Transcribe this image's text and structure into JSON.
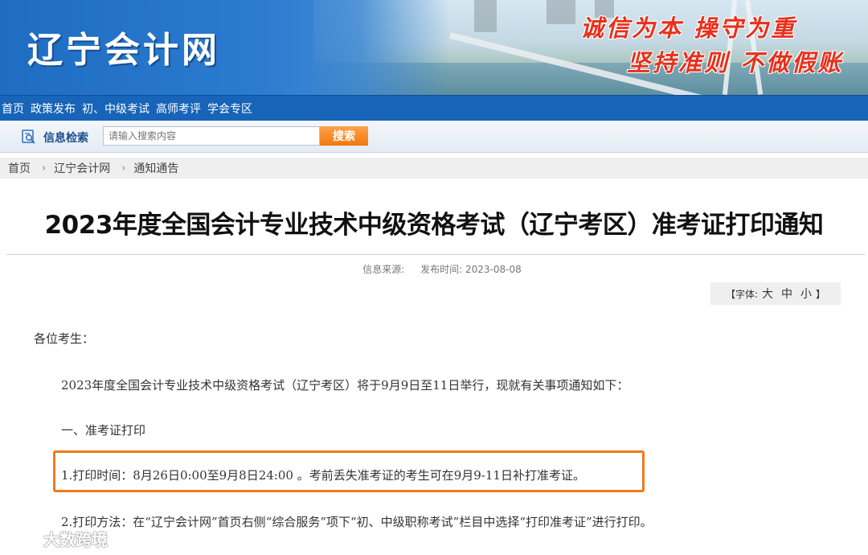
{
  "banner": {
    "logo": "辽宁会计网",
    "slogan_line1": "诚信为本 操守为重",
    "slogan_line2": "坚持准则 不做假账"
  },
  "nav": {
    "items": [
      "首页",
      "政策发布",
      "初、中级考试",
      "高师考评",
      "学会专区"
    ]
  },
  "search": {
    "title": "信息检索",
    "placeholder": "请输入搜索内容",
    "button": "搜索"
  },
  "breadcrumb": [
    "首页",
    "辽宁会计网",
    "通知通告"
  ],
  "article": {
    "title": "2023年度全国会计专业技术中级资格考试（辽宁考区）准考证打印通知",
    "source_label": "信息来源:",
    "date_label": "发布时间: 2023-08-08",
    "fontsize_label": "【字体:",
    "fontsize_options": [
      "大",
      "中",
      "小"
    ],
    "fontsize_close": "】",
    "greeting": "各位考生：",
    "intro": "2023年度全国会计专业技术中级资格考试（辽宁考区）将于9月9日至11日举行，现就有关事项通知如下：",
    "section1": "一、准考证打印",
    "print_time": "1.打印时间：8月26日0:00至9月8日24:00 。考前丢失准考证的考生可在9月9-11日补打准考证。",
    "print_method": "2.打印方法：在“辽宁会计网”首页右侧“综合服务”项下“初、中级职称考试”栏目中选择“打印准考证”进行打印。"
  },
  "watermark": "大数跨境",
  "colors": {
    "nav_bg": "#1764b8",
    "search_button": "#f0780f",
    "highlight_border": "#f07a1b",
    "slogan": "#e8301b"
  }
}
